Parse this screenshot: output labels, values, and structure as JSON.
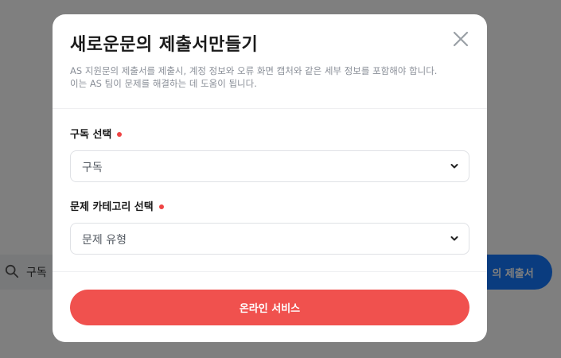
{
  "background": {
    "search_text": "구독 ",
    "submit_label": "의 제출서"
  },
  "modal": {
    "title": "새로운문의 제출서만들기",
    "description_line1": "AS 지원문의 제출서를 제출시, 계정 정보와 오류 화면 캡처와 같은 세부 정보를 포함해야 합니다.",
    "description_line2": "이는 AS 팀이 문제를 해결하는 데 도움이 됩니다.",
    "subscription_field": {
      "label": "구독 선택",
      "selected": "구독"
    },
    "category_field": {
      "label": "문제 카테고리 선택",
      "selected": "문제 유형"
    },
    "primary_button": "온라인 서비스"
  },
  "colors": {
    "required_dot": "#ef4444",
    "primary_button": "#f0514e",
    "background_button": "#1479ff"
  }
}
